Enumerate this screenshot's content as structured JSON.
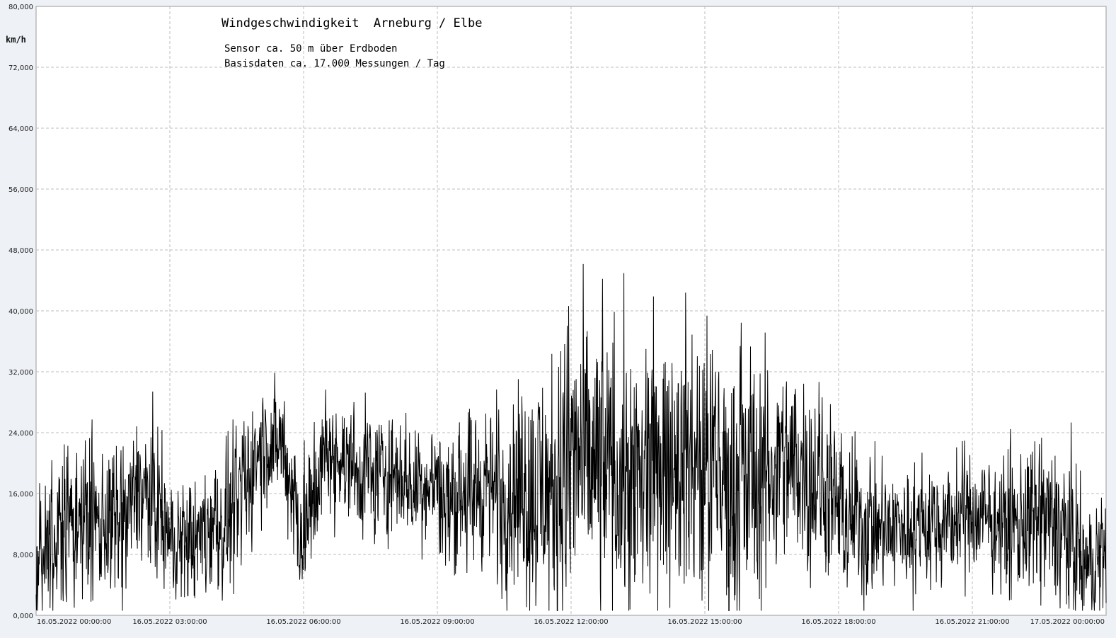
{
  "chart_data": {
    "type": "line",
    "title": "Windgeschwindigkeit  Arneburg / Elbe",
    "subtitle_lines": [
      "Sensor ca. 50 m über Erdboden",
      "Basisdaten ca. 17.000 Messungen / Tag"
    ],
    "ylabel": "km/h",
    "ylim": [
      0,
      80
    ],
    "yticks": [
      0,
      8,
      16,
      24,
      32,
      40,
      48,
      56,
      64,
      72,
      80
    ],
    "ytick_labels": [
      "0,000",
      "8,000",
      "16,000",
      "24,000",
      "32,000",
      "40,000",
      "48,000",
      "56,000",
      "64,000",
      "72,000",
      "80,000"
    ],
    "xlim_hours": [
      0,
      24
    ],
    "xticks_hours": [
      0,
      3,
      6,
      9,
      12,
      15,
      18,
      21,
      24
    ],
    "xtick_labels": [
      "16.05.2022  00:00:00",
      "16.05.2022  03:00:00",
      "16.05.2022  06:00:00",
      "16.05.2022  09:00:00",
      "16.05.2022  12:00:00",
      "16.05.2022  15:00:00",
      "16.05.2022  18:00:00",
      "16.05.2022  21:00:00",
      "17.05.2022  00:00:00"
    ],
    "grid": true,
    "line_color": "#000000",
    "series_profile": {
      "hours": [
        0,
        0.5,
        1,
        1.5,
        2,
        2.25,
        2.5,
        3,
        3.5,
        4,
        4.5,
        5,
        5.5,
        6,
        6.5,
        7,
        7.5,
        8,
        8.5,
        9,
        9.5,
        10,
        10.5,
        11,
        11.5,
        12,
        12.5,
        13,
        13.5,
        14,
        14.5,
        15,
        15.5,
        16,
        16.5,
        17,
        17.5,
        18,
        18.5,
        19,
        19.5,
        20,
        20.5,
        21,
        21.5,
        22,
        22.5,
        23,
        23.5,
        24
      ],
      "mean": [
        7,
        12,
        13,
        12,
        11,
        17,
        16,
        10,
        10,
        12,
        13,
        22,
        23,
        10,
        21,
        20,
        18,
        19,
        17,
        17,
        15,
        17,
        16,
        16,
        15,
        20,
        19,
        19,
        18,
        19,
        20,
        18,
        18,
        17,
        19,
        20,
        18,
        13,
        12,
        11,
        11,
        12,
        12,
        13,
        12,
        12,
        12,
        12,
        6,
        9
      ],
      "spread": [
        4,
        5,
        5,
        5,
        5,
        5,
        5,
        4,
        4,
        5,
        5,
        4,
        4,
        5,
        4,
        4,
        4,
        4,
        4,
        4,
        5,
        5,
        6,
        7,
        8,
        9,
        9,
        9,
        9,
        9,
        9,
        9,
        9,
        8,
        7,
        6,
        6,
        5,
        5,
        4,
        4,
        4,
        4,
        4,
        4,
        5,
        5,
        6,
        4,
        4
      ]
    }
  }
}
